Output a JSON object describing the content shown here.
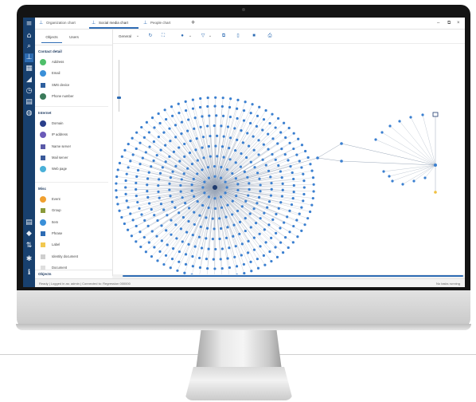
{
  "tabs": [
    {
      "label": "Organization chart",
      "active": false
    },
    {
      "label": "Social media chart",
      "active": true
    },
    {
      "label": "People chart",
      "active": false
    }
  ],
  "add_tab": "+",
  "window_controls": {
    "minimize": "–",
    "restore": "⧉",
    "close": "×"
  },
  "sidebar_nav": [
    {
      "icon": "menu-icon",
      "glyph": "≡"
    },
    {
      "icon": "home-icon",
      "glyph": "⌂"
    },
    {
      "icon": "search-icon",
      "glyph": "⌕"
    },
    {
      "icon": "org-chart-icon",
      "glyph": "⊥"
    },
    {
      "icon": "table-icon",
      "glyph": "▦"
    },
    {
      "icon": "analytics-icon",
      "glyph": "◢"
    },
    {
      "icon": "history-icon",
      "glyph": "◷"
    },
    {
      "icon": "document-icon",
      "glyph": "▤"
    },
    {
      "icon": "globe-icon",
      "glyph": "◍"
    },
    {
      "icon": "list-icon",
      "glyph": "▤"
    },
    {
      "icon": "tag-icon",
      "glyph": "◆"
    },
    {
      "icon": "sort-icon",
      "glyph": "⇅"
    },
    {
      "icon": "graph-icon",
      "glyph": "✱"
    },
    {
      "icon": "info-icon",
      "glyph": "ℹ"
    }
  ],
  "panel": {
    "subtabs": [
      "Objects",
      "Users"
    ],
    "sections": [
      {
        "title": "Contact detail",
        "items": [
          {
            "label": "Address",
            "color": "#4fbf6a",
            "shape": "dot"
          },
          {
            "label": "Email",
            "color": "#3a8fd8",
            "shape": "dot"
          },
          {
            "label": "SMS device",
            "color": "#2e5f9e",
            "shape": "sq"
          },
          {
            "label": "Phone number",
            "color": "#3b7a5a",
            "shape": "dot"
          }
        ]
      },
      {
        "title": "Internet",
        "items": [
          {
            "label": "Domain",
            "color": "#2a3f8a",
            "shape": "dot"
          },
          {
            "label": "IP address",
            "color": "#6a5ab8",
            "shape": "dot"
          },
          {
            "label": "Name server",
            "color": "#5a5aa8",
            "shape": "sq"
          },
          {
            "label": "Mail server",
            "color": "#3a5a9a",
            "shape": "sq"
          },
          {
            "label": "Web page",
            "color": "#4ab0d8",
            "shape": "dot"
          }
        ]
      },
      {
        "title": "Misc",
        "items": [
          {
            "label": "Event",
            "color": "#f0a030",
            "shape": "dot"
          },
          {
            "label": "Group",
            "color": "#8a9a3a",
            "shape": "sq"
          },
          {
            "label": "Item",
            "color": "#3a8fd8",
            "shape": "dot"
          },
          {
            "label": "Phrase",
            "color": "#2e6cb4",
            "shape": "sq"
          },
          {
            "label": "Label",
            "color": "#f2c850",
            "shape": "sq"
          },
          {
            "label": "Identity document",
            "color": "#cfcfcf",
            "shape": "sq"
          },
          {
            "label": "Document",
            "color": "#dedede",
            "shape": "sq"
          }
        ]
      }
    ],
    "objects_title": "Objects"
  },
  "toolbar": {
    "layout_select": "General",
    "icons": [
      "chevron-down-icon",
      "refresh-icon",
      "fit-screen-icon",
      "node-color-icon",
      "chevron-down-icon",
      "filter-icon",
      "chevron-down-icon",
      "copy-icon",
      "delete-icon",
      "save-icon",
      "print-icon"
    ]
  },
  "status": {
    "left": "Ready | Logged in as: admin | Connected to: Regression 000000",
    "right": "No tasks running"
  },
  "graph": {
    "hub_color": "#1e3a6e",
    "node_color": "#3a7fd0",
    "accent_node_color": "#f0c040",
    "edge_color": "#9aa7b8"
  }
}
